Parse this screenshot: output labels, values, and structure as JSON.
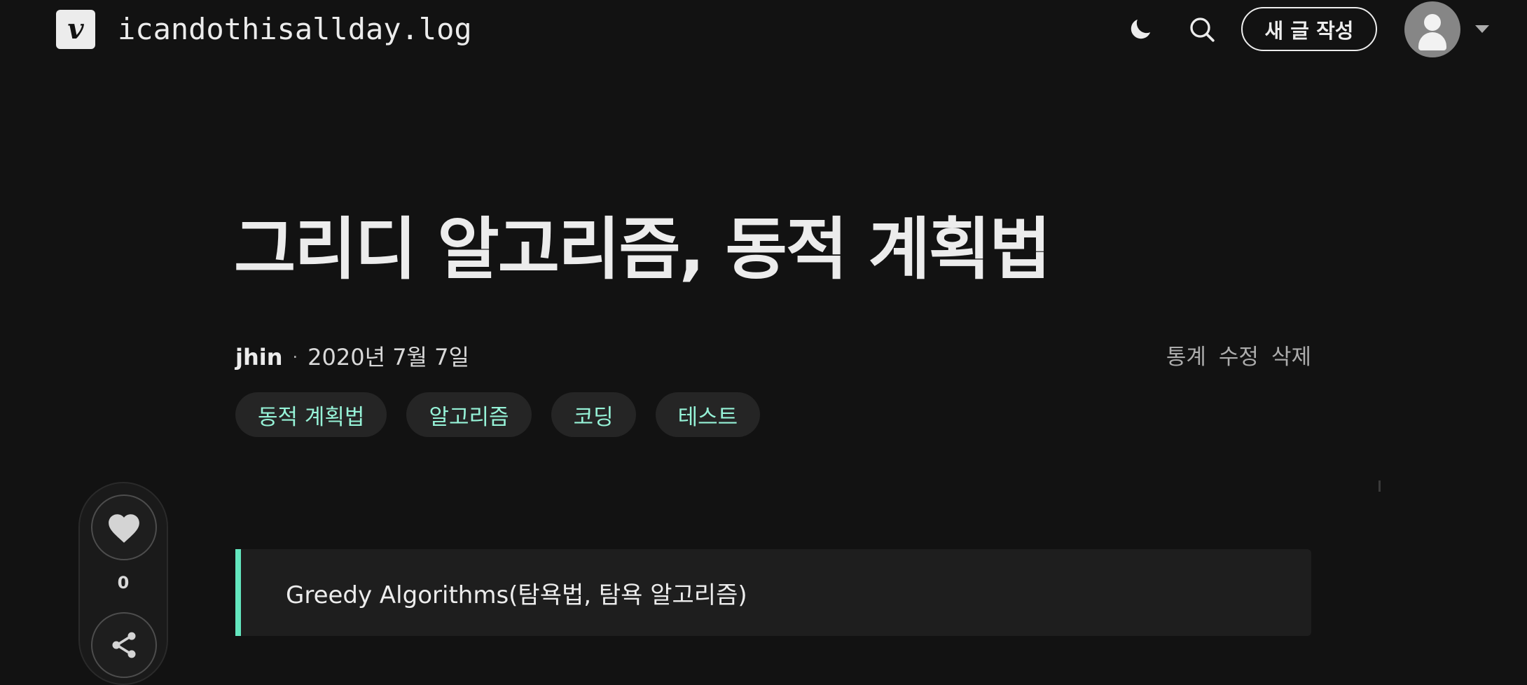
{
  "header": {
    "logo_letter": "v",
    "blog_title": "icandothisallday.log",
    "write_button_label": "새 글 작성"
  },
  "icons": {
    "theme": "moon-icon",
    "search": "search-icon",
    "avatar": "user-icon",
    "caret": "caret-down-icon",
    "like": "heart-icon",
    "share": "share-icon"
  },
  "post": {
    "title": "그리디 알고리즘, 동적 계획법",
    "author": "jhin",
    "separator": "·",
    "date": "2020년 7월 7일",
    "owner_actions": [
      "통계",
      "수정",
      "삭제"
    ],
    "tags": [
      "동적 계획법",
      "알고리즘",
      "코딩",
      "테스트"
    ],
    "like_count": "0",
    "blockquote": "Greedy Algorithms(탐욕법, 탐욕 알고리즘)"
  },
  "colors": {
    "background": "#121212",
    "text": "#ececec",
    "accent": "#63e6be",
    "tag_text": "#96f2d7",
    "tag_bg": "#252525",
    "muted": "#acacac"
  }
}
